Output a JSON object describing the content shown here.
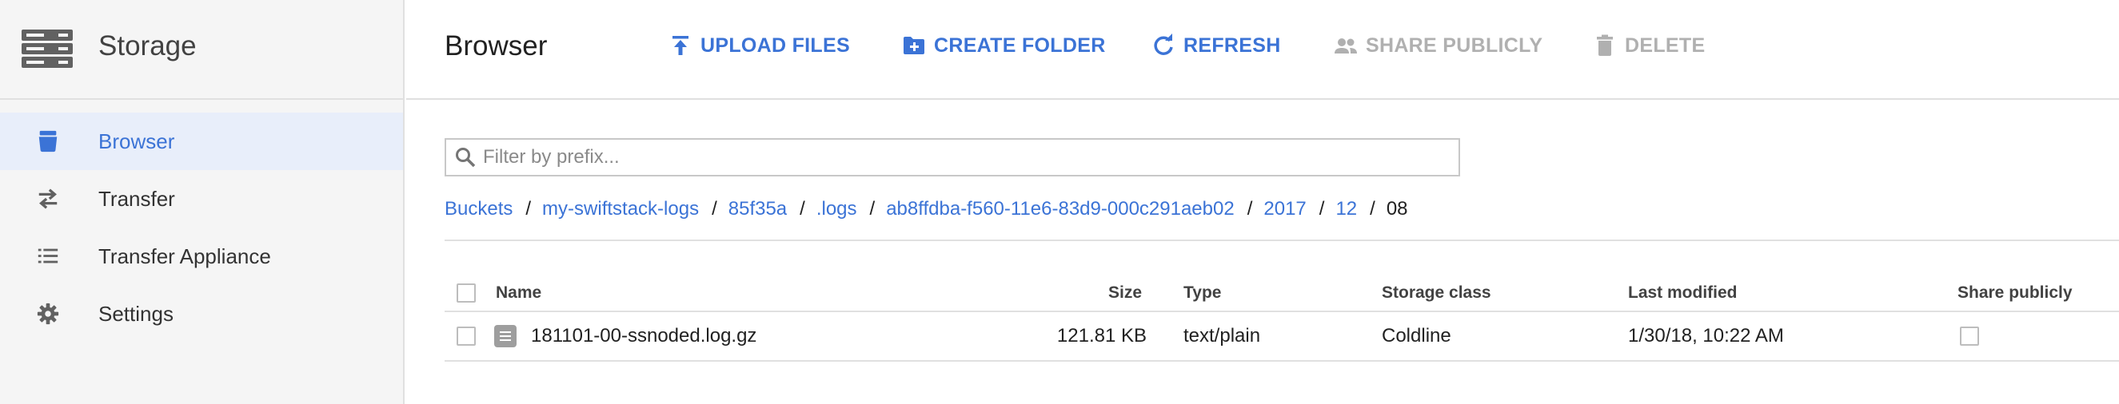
{
  "sidebar": {
    "title": "Storage",
    "items": [
      {
        "label": "Browser",
        "icon": "bucket-icon"
      },
      {
        "label": "Transfer",
        "icon": "swap-arrows-icon"
      },
      {
        "label": "Transfer Appliance",
        "icon": "list-icon"
      },
      {
        "label": "Settings",
        "icon": "gear-icon"
      }
    ]
  },
  "header": {
    "title": "Browser",
    "buttons": [
      {
        "label": "UPLOAD FILES",
        "icon": "upload-icon",
        "enabled": true
      },
      {
        "label": "CREATE FOLDER",
        "icon": "create-folder-icon",
        "enabled": true
      },
      {
        "label": "REFRESH",
        "icon": "refresh-icon",
        "enabled": true
      },
      {
        "label": "SHARE PUBLICLY",
        "icon": "share-people-icon",
        "enabled": false
      },
      {
        "label": "DELETE",
        "icon": "trash-icon",
        "enabled": false
      }
    ]
  },
  "filter": {
    "placeholder": "Filter by prefix...",
    "value": ""
  },
  "breadcrumb": {
    "items": [
      "Buckets",
      "my-swiftstack-logs",
      "85f35a",
      ".logs",
      "ab8ffdba-f560-11e6-83d9-000c291aeb02",
      "2017",
      "12",
      "08"
    ],
    "separator": "/"
  },
  "table": {
    "columns": {
      "name": "Name",
      "size": "Size",
      "type": "Type",
      "storage_class": "Storage class",
      "last_modified": "Last modified",
      "share_publicly": "Share publicly"
    },
    "rows": [
      {
        "name": "181101-00-ssnoded.log.gz",
        "size": "121.81 KB",
        "type": "text/plain",
        "storage_class": "Coldline",
        "last_modified": "1/30/18, 10:22 AM",
        "shared": false
      }
    ]
  },
  "colors": {
    "accent": "#3b73d6",
    "disabled": "#b0b0b0",
    "active_bg": "#e8eefa",
    "sidebar_bg": "#f5f5f5"
  }
}
